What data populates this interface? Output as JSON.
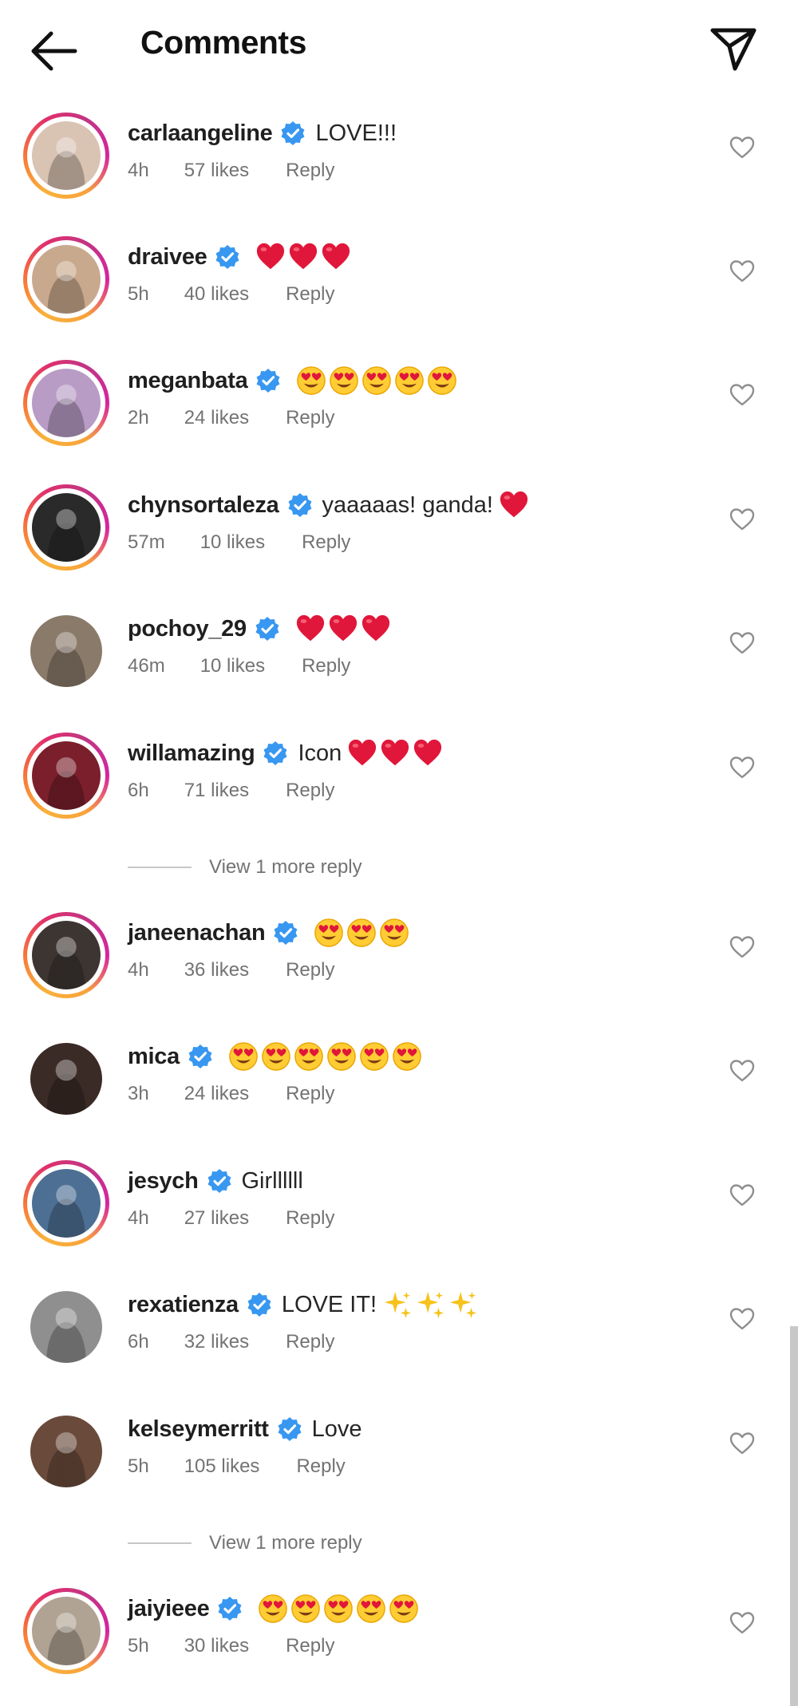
{
  "header": {
    "title": "Comments"
  },
  "comments": [
    {
      "username": "carlaangeline",
      "text": "LOVE!!!",
      "emoji": [],
      "time": "4h",
      "likes": "57 likes",
      "reply": "Reply",
      "ring": true,
      "avatar_bg": "#d9c3b3"
    },
    {
      "username": "draivee",
      "text": "",
      "emoji": [
        "heart",
        "heart",
        "heart"
      ],
      "time": "5h",
      "likes": "40 likes",
      "reply": "Reply",
      "ring": true,
      "avatar_bg": "#c9a98e"
    },
    {
      "username": "meganbata",
      "text": "",
      "emoji": [
        "heart-eyes",
        "heart-eyes",
        "heart-eyes",
        "heart-eyes",
        "heart-eyes"
      ],
      "time": "2h",
      "likes": "24 likes",
      "reply": "Reply",
      "ring": true,
      "avatar_bg": "#b89cc5"
    },
    {
      "username": "chynsortaleza",
      "text": "yaaaaas! ganda!",
      "emoji": [
        "heart"
      ],
      "time": "57m",
      "likes": "10 likes",
      "reply": "Reply",
      "ring": true,
      "avatar_bg": "#2a2a2a"
    },
    {
      "username": "pochoy_29",
      "text": "",
      "emoji": [
        "heart",
        "heart",
        "heart"
      ],
      "time": "46m",
      "likes": "10 likes",
      "reply": "Reply",
      "ring": false,
      "avatar_bg": "#8a7a6a"
    },
    {
      "username": "willamazing",
      "text": "Icon",
      "emoji": [
        "heart",
        "heart",
        "heart"
      ],
      "time": "6h",
      "likes": "71 likes",
      "reply": "Reply",
      "ring": true,
      "avatar_bg": "#7a1f2b"
    },
    {
      "username": "janeenachan",
      "text": "",
      "emoji": [
        "heart-eyes",
        "heart-eyes",
        "heart-eyes"
      ],
      "time": "4h",
      "likes": "36 likes",
      "reply": "Reply",
      "ring": true,
      "avatar_bg": "#3d3532"
    },
    {
      "username": "mica",
      "text": "",
      "emoji": [
        "heart-eyes",
        "heart-eyes",
        "heart-eyes",
        "heart-eyes",
        "heart-eyes",
        "heart-eyes"
      ],
      "time": "3h",
      "likes": "24 likes",
      "reply": "Reply",
      "ring": false,
      "avatar_bg": "#3b2b26"
    },
    {
      "username": "jesych",
      "text": "Girllllll",
      "emoji": [],
      "time": "4h",
      "likes": "27 likes",
      "reply": "Reply",
      "ring": true,
      "avatar_bg": "#4d6f93"
    },
    {
      "username": "rexatienza",
      "text": "LOVE IT!",
      "emoji": [
        "sparkles",
        "sparkles",
        "sparkles"
      ],
      "time": "6h",
      "likes": "32 likes",
      "reply": "Reply",
      "ring": false,
      "avatar_bg": "#8f8f8f"
    },
    {
      "username": "kelseymerritt",
      "text": "Love",
      "emoji": [],
      "time": "5h",
      "likes": "105 likes",
      "reply": "Reply",
      "ring": false,
      "avatar_bg": "#6a4a3a"
    },
    {
      "username": "jaiyieee",
      "text": "",
      "emoji": [
        "heart-eyes",
        "heart-eyes",
        "heart-eyes",
        "heart-eyes",
        "heart-eyes"
      ],
      "time": "5h",
      "likes": "30 likes",
      "reply": "Reply",
      "ring": true,
      "avatar_bg": "#b0a393"
    }
  ],
  "view_more": {
    "label": "View 1 more reply"
  },
  "colors": {
    "verified": "#3897f0",
    "heart": "#e0173a",
    "meta": "#737373"
  },
  "icons": [
    "back-arrow-icon",
    "send-icon",
    "verified-badge-icon",
    "heart-outline-icon"
  ]
}
